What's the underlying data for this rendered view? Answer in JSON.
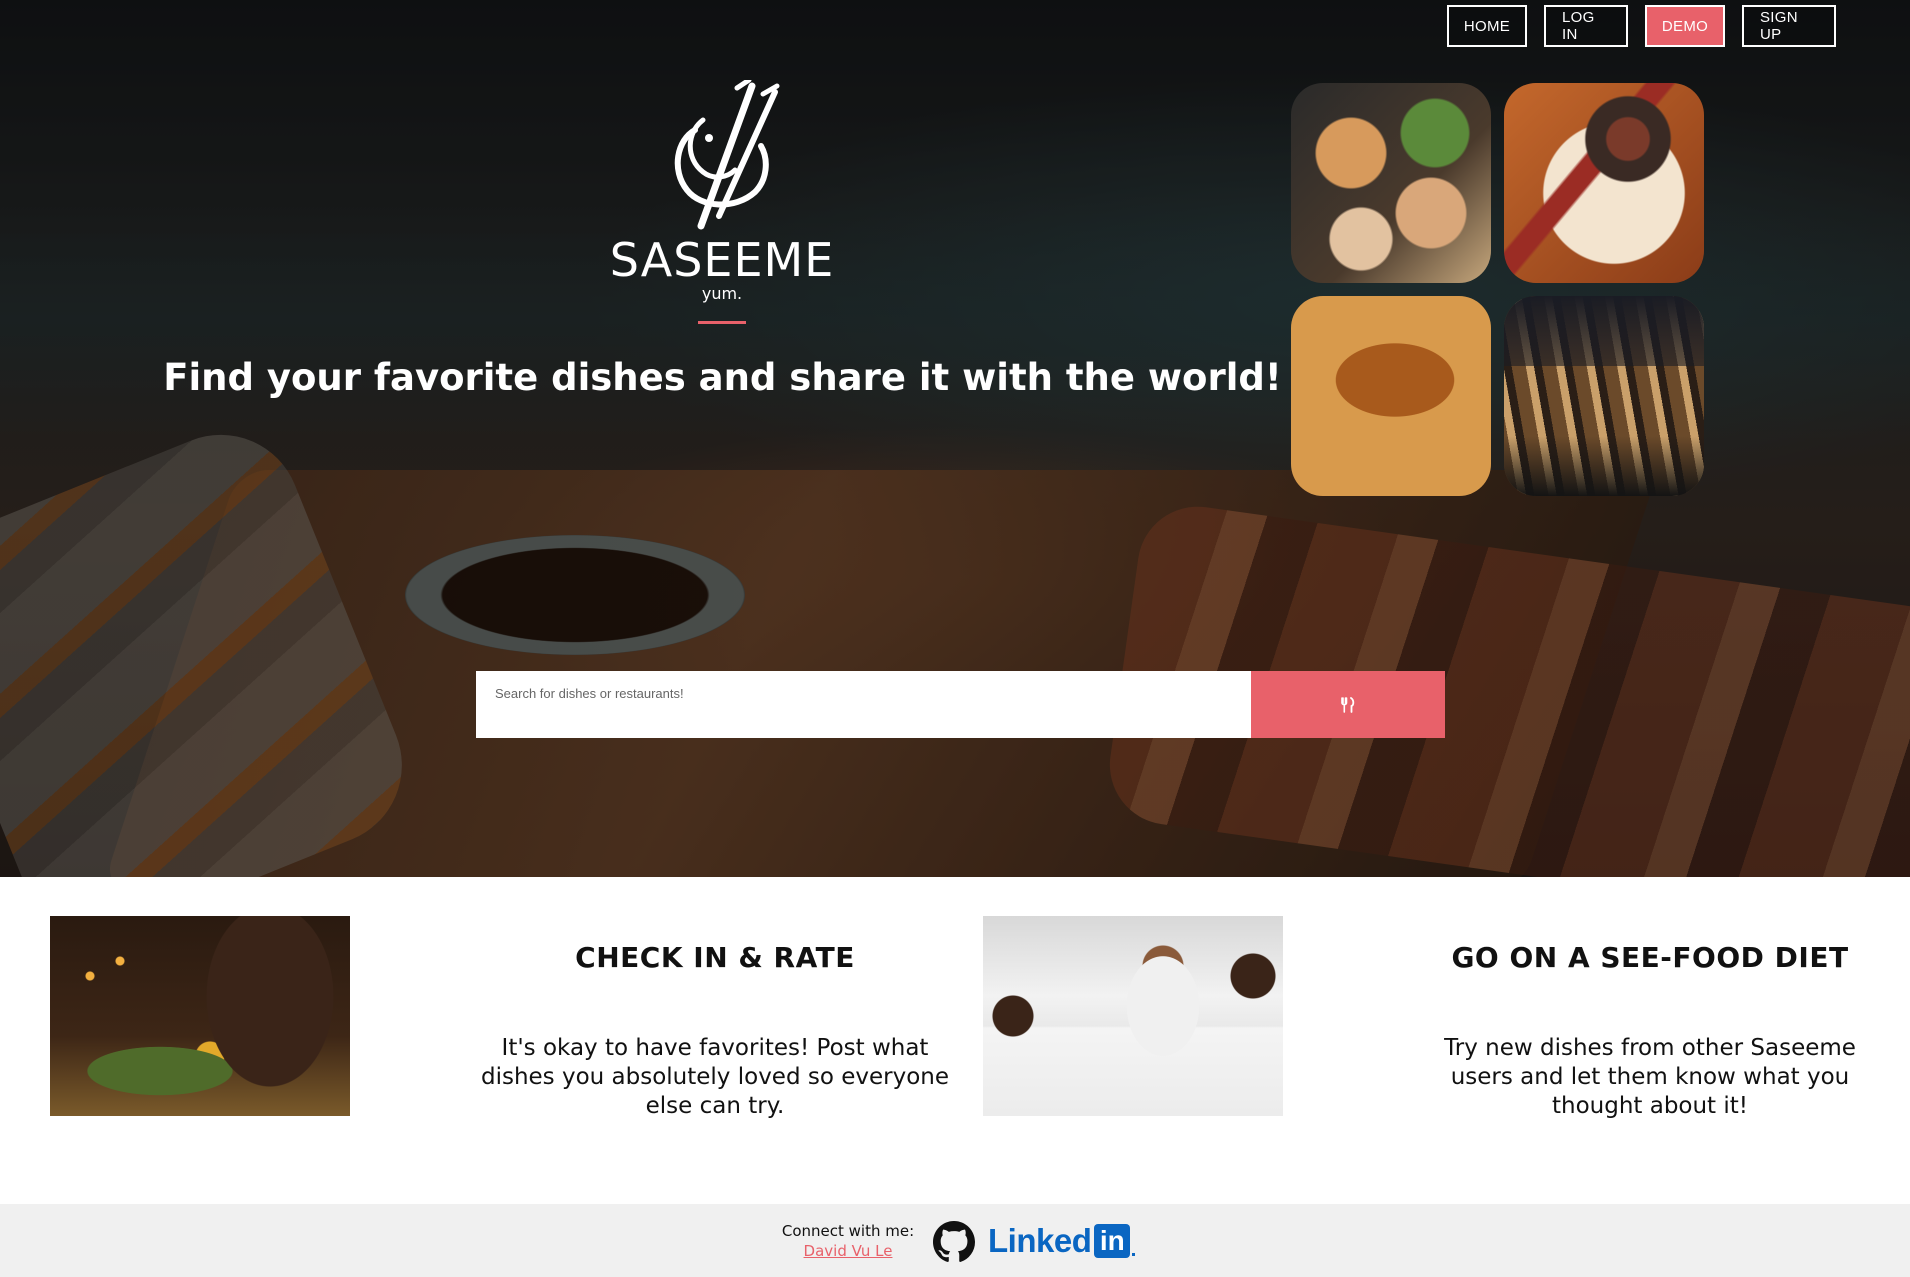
{
  "nav": {
    "home": "HOME",
    "login": "LOG IN",
    "demo": "DEMO",
    "signup": "SIGN UP"
  },
  "brand": {
    "name": "SASEEME",
    "tagline": "yum.",
    "logo_icon": "chopsticks-fish-logo"
  },
  "hero": {
    "headline": "Find your favorite dishes and share it with the world!",
    "tiles": [
      "oyster-dish-image",
      "sausage-plate-image",
      "creme-brulee-image",
      "pastry-platter-image"
    ]
  },
  "search": {
    "placeholder": "Search for dishes or restaurants!",
    "button_icon": "fork-knife-icon"
  },
  "features": [
    {
      "image": "woman-dining-image",
      "title": "CHECK IN & RATE",
      "description": "It's okay to have favorites! Post what dishes you absolutely loved so everyone else can try."
    },
    {
      "image": "family-dinner-image",
      "title": "GO ON A SEE-FOOD DIET",
      "description": "Try new dishes from other Saseeme users and let them know what you thought about it!"
    }
  ],
  "footer": {
    "connect_label": "Connect with me:",
    "author": "David Vu Le",
    "github_icon": "github-icon",
    "linkedin_word": "Linked",
    "linkedin_box": "in"
  },
  "colors": {
    "accent": "#e8616a",
    "linkedin": "#0a66c2",
    "footer_bg": "#f0f0f0"
  }
}
